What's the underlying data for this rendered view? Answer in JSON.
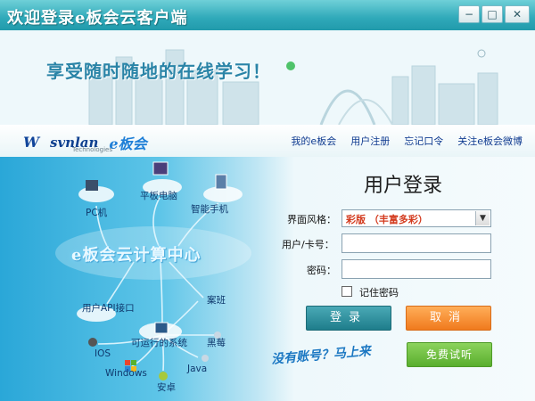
{
  "window": {
    "title": "欢迎登录e板会云客户端",
    "controls": {
      "minimize": "−",
      "maximize": "□",
      "close": "✕"
    }
  },
  "banner": {
    "slogan": "享受随时随地的在线学习！"
  },
  "brand": {
    "mark": "W",
    "name": "svnlan",
    "subtitle": "Technologies",
    "product": "e板会"
  },
  "nav": {
    "links": [
      "我的e板会",
      "用户注册",
      "忘记口令",
      "关注e板会微博"
    ]
  },
  "diagram": {
    "center": "e板会云计算中心",
    "nodes": {
      "pc": "PC机",
      "tablet": "平板电脑",
      "phone": "智能手机",
      "api": "用户API接口",
      "classroom": "案班",
      "runnable": "可运行的系统",
      "blackberry": "黑莓",
      "ios": "IOS",
      "windows": "Windows",
      "java": "Java",
      "android": "安卓"
    },
    "promo": "没有账号？马上来"
  },
  "login": {
    "title": "用户登录",
    "style_label": "界面风格：",
    "style_value": "彩版 （丰富多彩）",
    "user_label": "用户/卡号：",
    "password_label": "密码：",
    "remember_label": "记住密码",
    "login_button": "登录",
    "cancel_button": "取消",
    "trial_button": "免费试听"
  },
  "colors": {
    "titlebar": "#2fa9b9",
    "accent_blue": "#113c91",
    "login_button": "#1e7d8b",
    "cancel_button": "#f07a1d",
    "trial_button": "#59ae2e"
  }
}
